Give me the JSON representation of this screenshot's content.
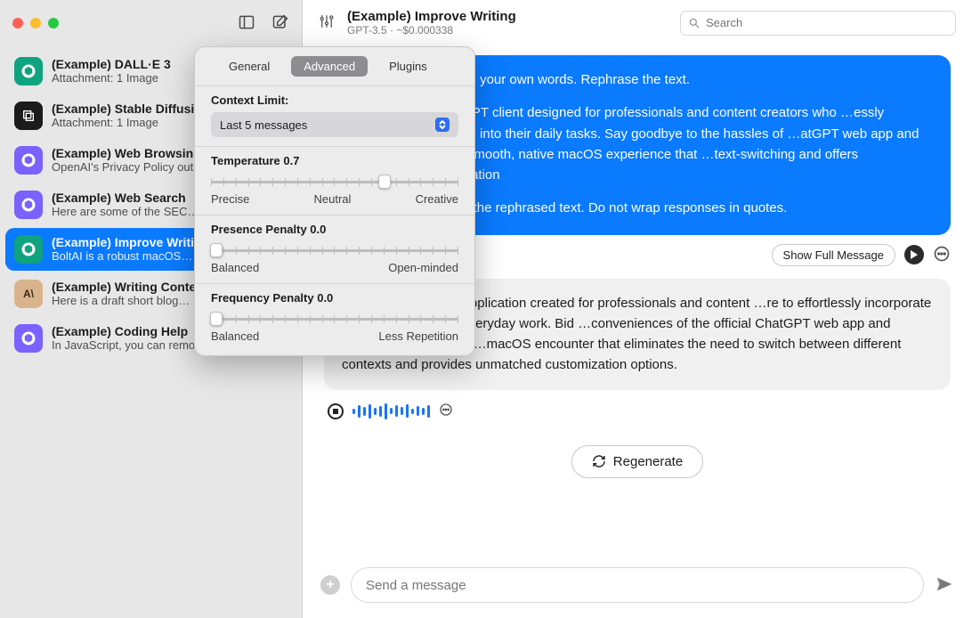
{
  "header": {
    "title": "(Example) Improve Writing",
    "subtitle": "GPT-3.5 · ~$0.000338",
    "search_placeholder": "Search"
  },
  "sidebar": {
    "items": [
      {
        "title": "(Example) DALL·E 3",
        "sub": "Attachment: 1 Image",
        "avatar": "openai"
      },
      {
        "title": "(Example) Stable Diffusion",
        "sub": "Attachment: 1 Image",
        "avatar": "dark"
      },
      {
        "title": "(Example) Web Browsing",
        "sub": "OpenAI's Privacy Policy outlines…",
        "avatar": "purple"
      },
      {
        "title": "(Example) Web Search",
        "sub": "Here are some of the SEC…",
        "avatar": "purple"
      },
      {
        "title": "(Example) Improve Writing",
        "sub": "BoltAI is a robust macOS…",
        "avatar": "openai",
        "selected": true
      },
      {
        "title": "(Example) Writing Content",
        "sub": "Here is a draft short blog…",
        "avatar": "tan",
        "avatar_text": "A\\"
      },
      {
        "title": "(Example) Coding Help",
        "sub": "In JavaScript, you can remove a specific i…",
        "avatar": "purple"
      }
    ]
  },
  "popover": {
    "tabs": {
      "general": "General",
      "advanced": "Advanced",
      "plugins": "Plugins",
      "active": "advanced"
    },
    "context_limit": {
      "label": "Context Limit:",
      "value": "Last 5 messages"
    },
    "temperature": {
      "label": "Temperature 0.7",
      "left": "Precise",
      "mid": "Neutral",
      "right": "Creative",
      "pos": 0.7
    },
    "presence": {
      "label": "Presence Penalty 0.0",
      "left": "Balanced",
      "right": "Open-minded",
      "pos": 0.0
    },
    "frequency": {
      "label": "Frequency Penalty 0.0",
      "left": "Balanced",
      "right": "Less Repetition",
      "pos": 0.0
    }
  },
  "chat": {
    "user": {
      "p1": "…text in triple below in your own words. Rephrase the text.",
      "p2": "…erful macOS ChatGPT client designed for professionals and content creators who …essly integrate AI assistance into their daily tasks. Say goodbye to the hassles of …atGPT web app and switch to BoltAI for a smooth, native macOS experience that …text-switching and offers unparalleled customization",
      "p3": "…anything other than the rephrased text. Do not wrap responses in quotes."
    },
    "show_full": "Show Full Message",
    "assistant": "…macOS ChatGPT application created for professionals and content …re to effortlessly incorporate AI support into their everyday work. Bid …conveniences of the official ChatGPT web app and transition to BoltAI for …macOS encounter that eliminates the need to switch between different contexts and provides unmatched customization options.",
    "regenerate": "Regenerate",
    "composer_placeholder": "Send a message"
  }
}
